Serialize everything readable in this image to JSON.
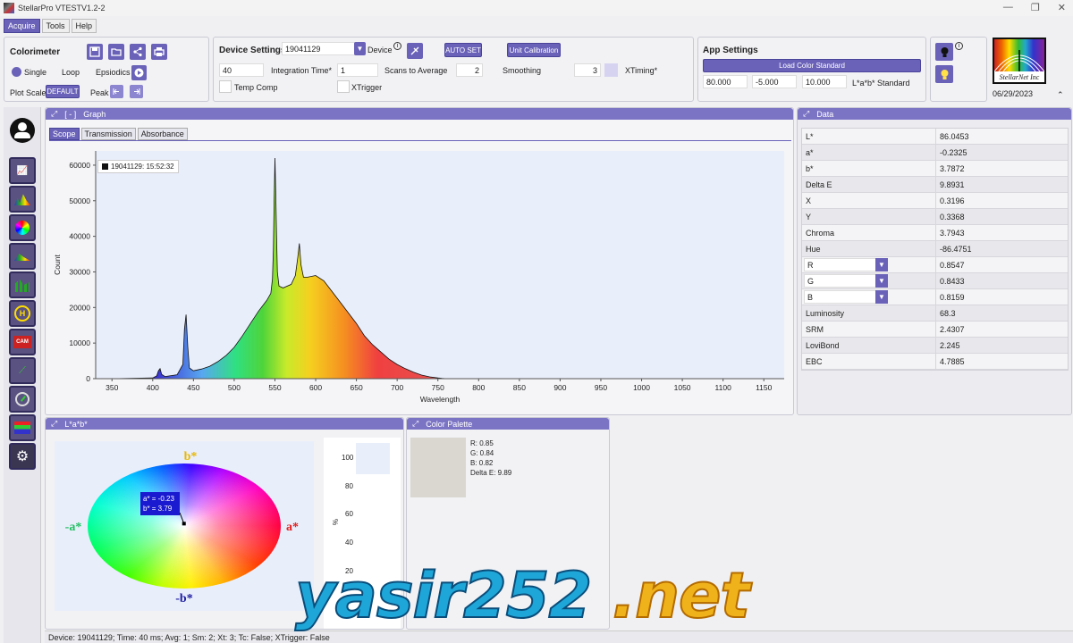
{
  "window": {
    "title": "StellarPro VTESTV1.2-2",
    "minimize": "—",
    "restore": "❐",
    "close": "✕"
  },
  "menu": {
    "items": [
      {
        "label": "Acquire",
        "active": true
      },
      {
        "label": "Tools",
        "active": false
      },
      {
        "label": "Help",
        "active": false
      }
    ]
  },
  "colorimeter": {
    "title": "Colorimeter",
    "modes": [
      {
        "label": "Single",
        "selected": true
      },
      {
        "label": "Loop",
        "selected": false
      },
      {
        "label": "Epsiodics",
        "selected": false
      }
    ],
    "plot_scale_label": "Plot Scale",
    "plot_scale_value": "DEFAULT",
    "peak_label": "Peak",
    "icons": [
      "save-icon",
      "folder-open-icon",
      "share-icon",
      "print-icon",
      "play-icon",
      "arrow-left-bar-icon",
      "arrow-right-bar-icon"
    ]
  },
  "device_settings": {
    "title": "Device Settings",
    "device_id": "19041129",
    "device_label": "Device",
    "info": "i",
    "auto_set": "AUTO SET",
    "unit_calibration": "Unit Calibration",
    "integration_time_value": "40",
    "integration_time_label": "Integration Time*",
    "scans_value": "1",
    "scans_label": "Scans to Average",
    "smoothing_value": "2",
    "smoothing_label": "Smoothing",
    "xtiming_value": "3",
    "xtiming_label": "XTiming*",
    "temp_comp_label": "Temp Comp",
    "xtrigger_label": "XTrigger"
  },
  "app_settings": {
    "title": "App Settings",
    "load_color_standard": "Load Color Standard",
    "standard_values": [
      "80.000",
      "-5.000",
      "10.000"
    ],
    "standard_label": "L*a*b* Standard"
  },
  "logo": {
    "date": "06/29/2023",
    "text": "StellarNet Inc"
  },
  "graph": {
    "title": "Graph",
    "collapse": "[ - ]",
    "tabs": [
      {
        "label": "Scope",
        "active": true
      },
      {
        "label": "Transmission",
        "active": false
      },
      {
        "label": "Absorbance",
        "active": false
      }
    ],
    "legend": "19041129:  15:52:32"
  },
  "chart_data": {
    "type": "line",
    "xlabel": "Wavelength",
    "ylabel": "Count",
    "xlim": [
      330,
      1175
    ],
    "ylim": [
      0,
      64000
    ],
    "x_ticks": [
      350,
      400,
      450,
      500,
      550,
      600,
      650,
      700,
      750,
      800,
      850,
      900,
      950,
      1000,
      1050,
      1100,
      1150
    ],
    "y_ticks": [
      0,
      10000,
      20000,
      30000,
      40000,
      50000,
      60000
    ],
    "grid": false,
    "legend_position": "top-left",
    "series": [
      {
        "name": "19041129:  15:52:32",
        "x": [
          350,
          400,
          405,
          407,
          409,
          411,
          415,
          430,
          437,
          439,
          441,
          443,
          445,
          450,
          460,
          470,
          480,
          490,
          500,
          510,
          520,
          530,
          540,
          545,
          547,
          548,
          549,
          550,
          551,
          552,
          553,
          555,
          560,
          570,
          575,
          578,
          580,
          582,
          585,
          590,
          600,
          610,
          620,
          630,
          640,
          650,
          660,
          670,
          680,
          690,
          700,
          710,
          720,
          730,
          740,
          750,
          755,
          760
        ],
        "y": [
          0,
          200,
          800,
          2200,
          2800,
          1200,
          600,
          1100,
          4000,
          14000,
          18000,
          9000,
          3000,
          2200,
          2700,
          3500,
          4800,
          6500,
          8800,
          12000,
          15500,
          19000,
          22000,
          24000,
          28000,
          36000,
          50000,
          62000,
          52000,
          40000,
          30000,
          26000,
          25500,
          26500,
          29000,
          34000,
          38000,
          32000,
          28500,
          28500,
          29000,
          27500,
          24500,
          21500,
          18500,
          15500,
          12000,
          9500,
          7500,
          5500,
          4000,
          2800,
          1800,
          1000,
          500,
          200,
          80,
          0
        ]
      }
    ]
  },
  "data_panel": {
    "title": "Data",
    "rows": [
      {
        "label": "L*",
        "value": "86.0453"
      },
      {
        "label": "a*",
        "value": "-0.2325"
      },
      {
        "label": "b*",
        "value": "3.7872"
      },
      {
        "label": "Delta E",
        "value": "9.8931"
      },
      {
        "label": "X",
        "value": "0.3196"
      },
      {
        "label": "Y",
        "value": "0.3368"
      },
      {
        "label": "Chroma",
        "value": "3.7943"
      },
      {
        "label": "Hue",
        "value": "-86.4751"
      },
      {
        "label": "R",
        "value": "0.8547",
        "dropdown": true
      },
      {
        "label": "G",
        "value": "0.8433",
        "dropdown": true
      },
      {
        "label": "B",
        "value": "0.8159",
        "dropdown": true
      },
      {
        "label": "Luminosity",
        "value": "68.3"
      },
      {
        "label": "SRM",
        "value": "2.4307"
      },
      {
        "label": "LoviBond",
        "value": "2.245"
      },
      {
        "label": "EBC",
        "value": "4.7885"
      }
    ]
  },
  "lab": {
    "title": "L*a*b*",
    "b_plus": "b*",
    "a_plus": "a*",
    "a_minus": "-a*",
    "b_minus": "-b*",
    "tooltip_a": "a* = -0.23",
    "tooltip_b": "b* = 3.79",
    "a_value": -0.23,
    "b_value": 3.79,
    "axis_range": 100,
    "bar_ticks": [
      "100",
      "80",
      "60",
      "40",
      "20"
    ],
    "bar_unit": "%",
    "lightness_fraction": 0.86
  },
  "palette": {
    "title": "Color Palette",
    "swatch_color": "#d9d7d0",
    "lines": [
      "R: 0.85",
      "G: 0.84",
      "B: 0.82",
      "Delta E: 9.89"
    ]
  },
  "status": "Device: 19041129; Time: 40 ms; Avg: 1; Sm: 2; Xt: 3; Tc: False; XTrigger: False",
  "watermark": {
    "part1": "yasir252",
    "part2": ".net"
  },
  "colors": {
    "accent": "#6a62b9",
    "title_bar": "#7b74c4",
    "plot_bg": "#e9eefb"
  }
}
